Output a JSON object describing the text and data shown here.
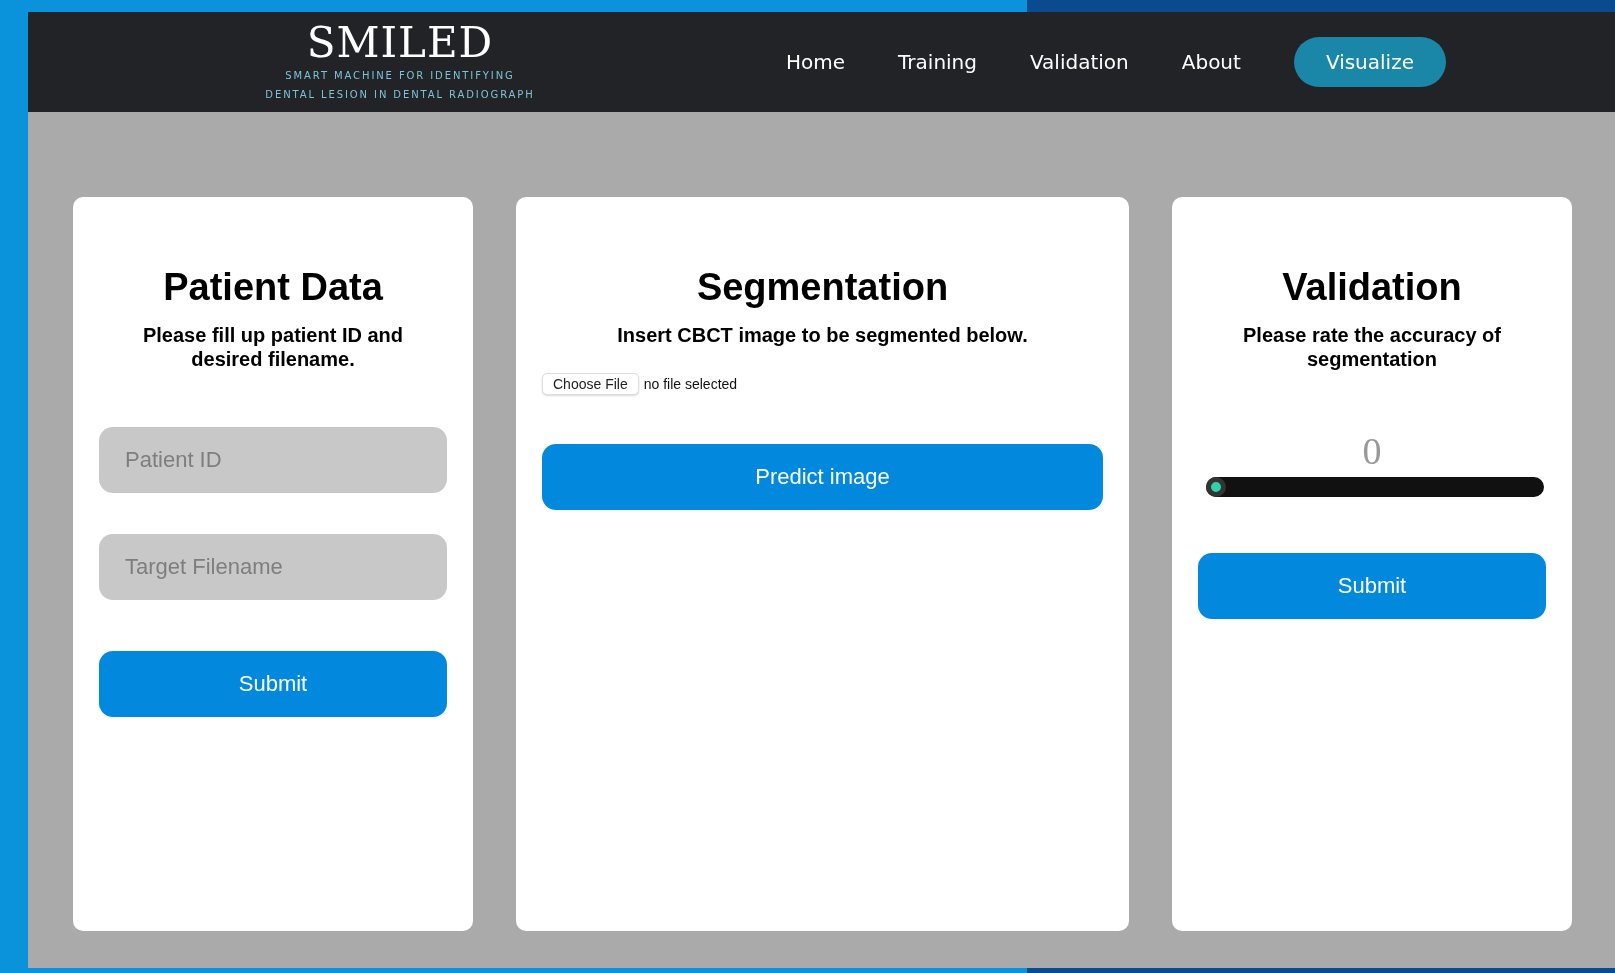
{
  "header": {
    "logo": {
      "title": "SMILED",
      "tagline_lines": [
        "SMART MACHINE FOR IDENTIFYING",
        "DENTAL LESION IN DENTAL RADIOGRAPH"
      ]
    },
    "nav": [
      {
        "label": "Home",
        "selected": false
      },
      {
        "label": "Training",
        "selected": false
      },
      {
        "label": "Validation",
        "selected": false
      },
      {
        "label": "About",
        "selected": false
      },
      {
        "label": "Visualize",
        "selected": true
      }
    ]
  },
  "cards": [
    {
      "kind": "form",
      "title": "Patient Data",
      "subtitle": "Please fill up patient ID and desired filename.",
      "fields": [
        {
          "placeholder": "Patient ID"
        },
        {
          "placeholder": "Target Filename"
        }
      ],
      "button": "Submit"
    },
    {
      "kind": "upload",
      "title": "Segmentation",
      "subtitle": "Insert CBCT image to be segmented below.",
      "file_button": "Choose File",
      "file_status": "no file selected",
      "button": "Predict image"
    },
    {
      "kind": "rating",
      "title": "Validation",
      "subtitle": "Please rate the accuracy of segmentation",
      "reading": "0",
      "slider": {
        "level": 0
      },
      "button": "Submit"
    }
  ]
}
